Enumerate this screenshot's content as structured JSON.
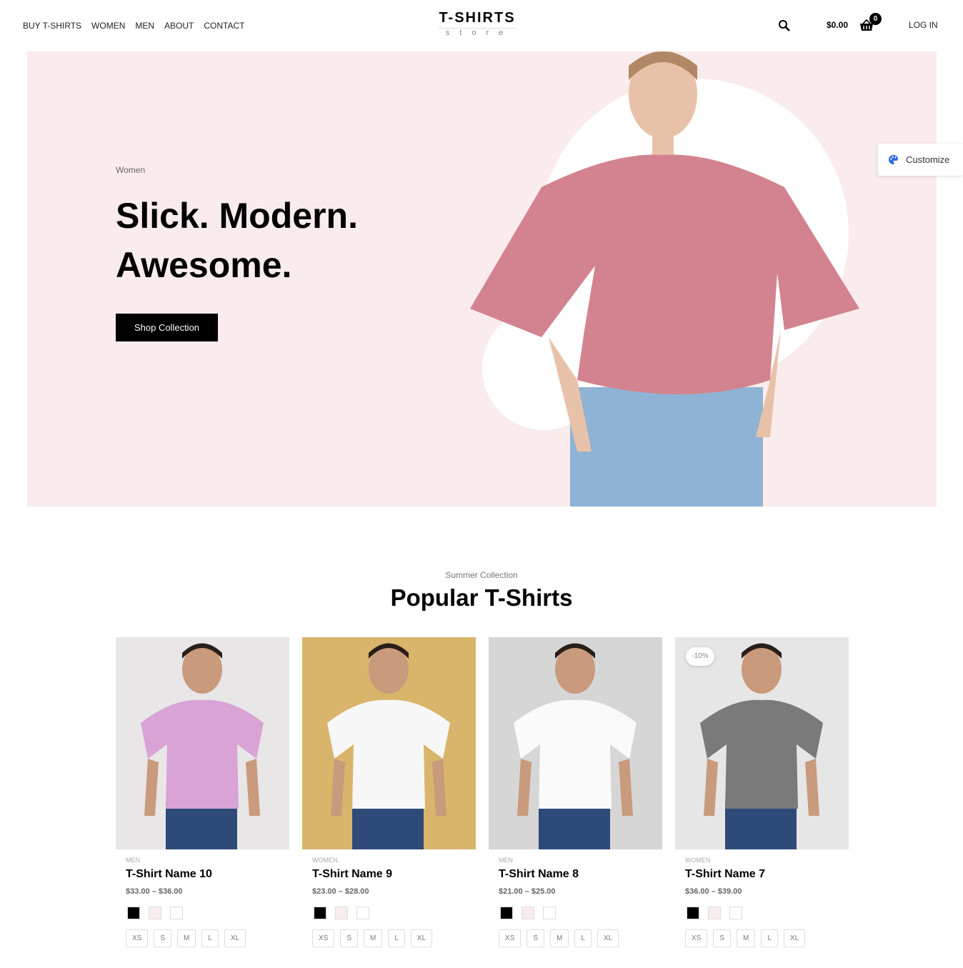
{
  "header": {
    "nav": [
      "BUY T-SHIRTS",
      "WOMEN",
      "MEN",
      "ABOUT",
      "CONTACT"
    ],
    "logo_title": "T-SHIRTS",
    "logo_sub": "store",
    "cart_total": "$0.00",
    "cart_count": "0",
    "login": "LOG IN"
  },
  "hero": {
    "eyebrow": "Women",
    "headline": "Slick. Modern. Awesome.",
    "button": "Shop Collection",
    "bg_color": "#faecec"
  },
  "customize": {
    "label": "Customize",
    "accent": "#2d6cdf"
  },
  "section": {
    "eyebrow": "Summer Collection",
    "title": "Popular T-Shirts"
  },
  "products": [
    {
      "category": "MEN",
      "name": "T-Shirt Name 10",
      "price": "$33.00 – $36.00",
      "sale": "",
      "img_bg": "#e8e6e7",
      "shirt": "#d9a3d6"
    },
    {
      "category": "WOMEN",
      "name": "T-Shirt Name 9",
      "price": "$23.00 – $28.00",
      "sale": "",
      "img_bg": "#d8b56a",
      "shirt": "#f7f7f7"
    },
    {
      "category": "MEN",
      "name": "T-Shirt Name 8",
      "price": "$21.00 – $25.00",
      "sale": "",
      "img_bg": "#d6d6d6",
      "shirt": "#fafafa"
    },
    {
      "category": "WOMEN",
      "name": "T-Shirt Name 7",
      "price": "$36.00 – $39.00",
      "sale": "-10%",
      "img_bg": "#e6e6e6",
      "shirt": "#7a7a7a"
    }
  ],
  "swatches": [
    "#000000",
    "#faecec",
    "#ffffff"
  ],
  "sizes": [
    "XS",
    "S",
    "M",
    "L",
    "XL"
  ]
}
